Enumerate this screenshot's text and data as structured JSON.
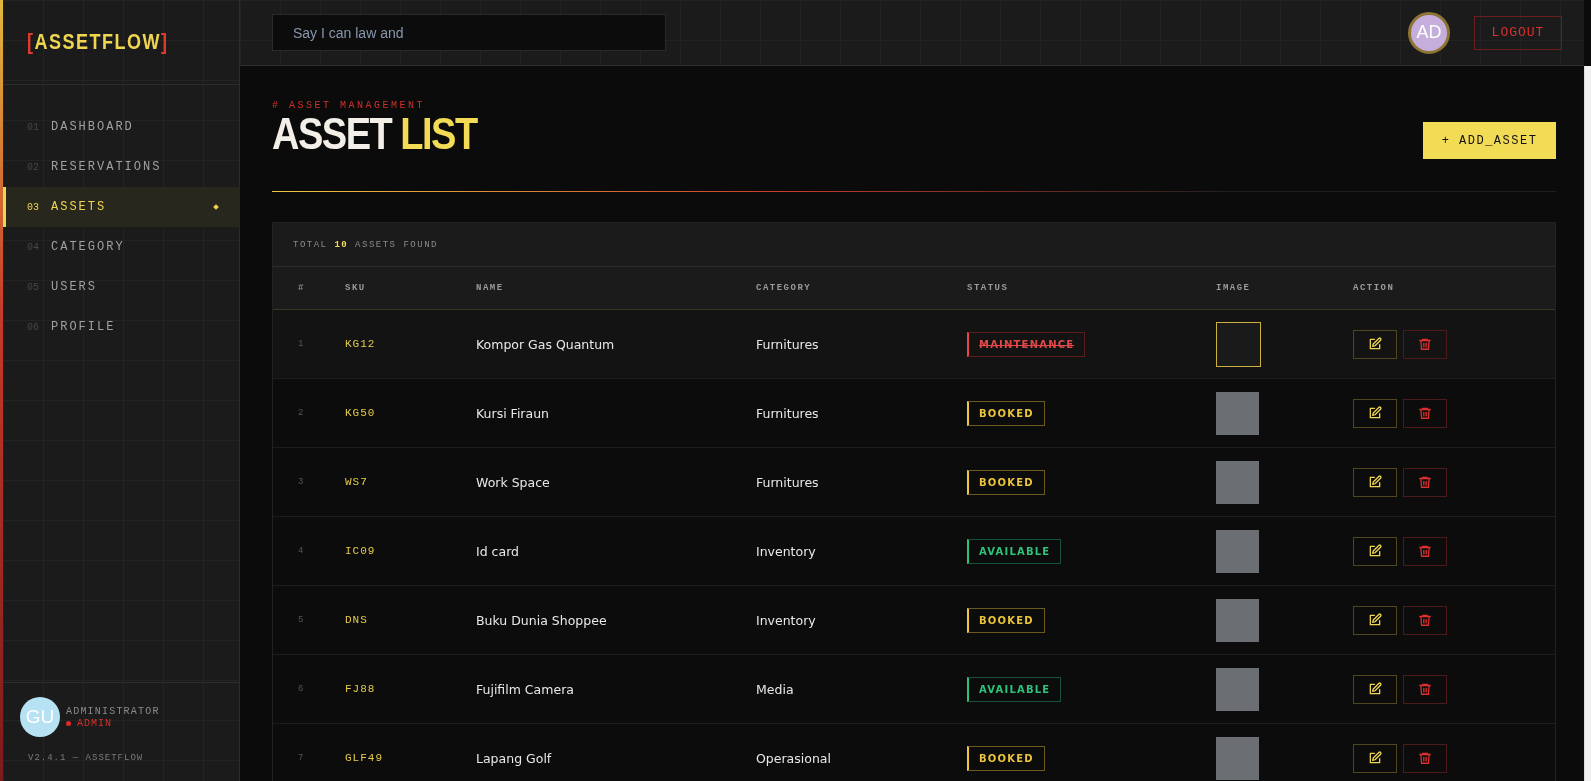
{
  "sidebar": {
    "logo": {
      "open": "[",
      "name": "ASSETFLOW",
      "close": "]"
    },
    "nav": [
      {
        "number": "01",
        "label": "DASHBOARD",
        "selected": false
      },
      {
        "number": "02",
        "label": "RESERVATIONS",
        "selected": false
      },
      {
        "number": "03",
        "label": "ASSETS",
        "selected": true
      },
      {
        "number": "04",
        "label": "CATEGORY",
        "selected": false
      },
      {
        "number": "05",
        "label": "USERS",
        "selected": false
      },
      {
        "number": "06",
        "label": "PROFILE",
        "selected": false
      }
    ],
    "user": {
      "initials": "GU",
      "name": "ADMINISTRATOR",
      "role": "ADMIN"
    },
    "version": "V2.4.1 — ASSETFLOW"
  },
  "topbar": {
    "search": {
      "value": "Say I can law and"
    },
    "avatar": "AD",
    "logout": "LOGOUT"
  },
  "header": {
    "eyebrow": "# ASSET MANAGEMENT",
    "title_main": "ASSET",
    "title_accent": "LIST",
    "add_button": "+ ADD_ASSET"
  },
  "table": {
    "summary": {
      "prefix": "TOTAL",
      "count": "10",
      "suffix": "ASSETS FOUND"
    },
    "columns": [
      "#",
      "SKU",
      "NAME",
      "CATEGORY",
      "STATUS",
      "IMAGE",
      "ACTION"
    ],
    "rows": [
      {
        "index": "1",
        "sku": "KG12",
        "name": "Kompor Gas Quantum",
        "category": "Furnitures",
        "status": "MAINTENANCE",
        "kind": "maintenance",
        "selected": true
      },
      {
        "index": "2",
        "sku": "KG50",
        "name": "Kursi Firaun",
        "category": "Furnitures",
        "status": "BOOKED",
        "kind": "booked",
        "selected": false
      },
      {
        "index": "3",
        "sku": "WS7",
        "name": "Work Space",
        "category": "Furnitures",
        "status": "BOOKED",
        "kind": "booked",
        "selected": false
      },
      {
        "index": "4",
        "sku": "IC09",
        "name": "Id card",
        "category": "Inventory",
        "status": "AVAILABLE",
        "kind": "available",
        "selected": false
      },
      {
        "index": "5",
        "sku": "DNS",
        "name": "Buku Dunia Shoppee",
        "category": "Inventory",
        "status": "BOOKED",
        "kind": "booked",
        "selected": false
      },
      {
        "index": "6",
        "sku": "FJ88",
        "name": "Fujifilm Camera",
        "category": "Media",
        "status": "AVAILABLE",
        "kind": "available",
        "selected": false
      },
      {
        "index": "7",
        "sku": "GLF49",
        "name": "Lapang Golf",
        "category": "Operasional",
        "status": "BOOKED",
        "kind": "booked",
        "selected": false
      }
    ]
  }
}
